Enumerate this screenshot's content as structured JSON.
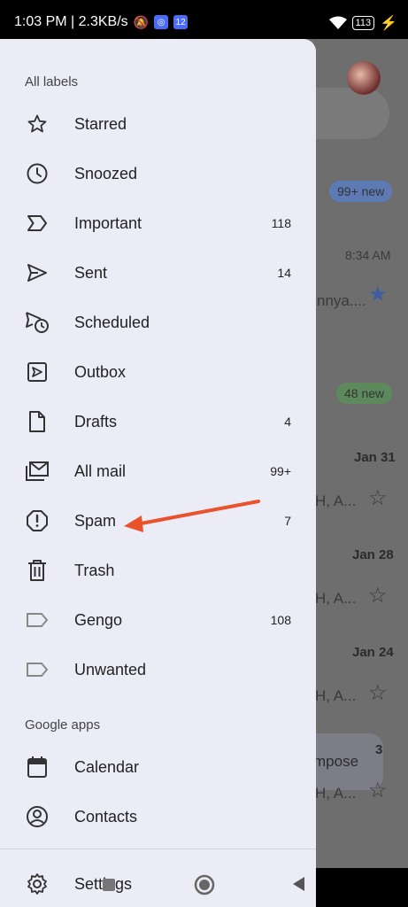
{
  "status_bar": {
    "time_info": "1:03 PM | 2.3KB/s",
    "sim_badge": "12",
    "battery": "113"
  },
  "drawer": {
    "all_labels_title": "All labels",
    "items": [
      {
        "label": "Starred",
        "count": "",
        "icon": "star-icon"
      },
      {
        "label": "Snoozed",
        "count": "",
        "icon": "clock-icon"
      },
      {
        "label": "Important",
        "count": "118",
        "icon": "important-icon"
      },
      {
        "label": "Sent",
        "count": "14",
        "icon": "send-icon"
      },
      {
        "label": "Scheduled",
        "count": "",
        "icon": "scheduled-icon"
      },
      {
        "label": "Outbox",
        "count": "",
        "icon": "outbox-icon"
      },
      {
        "label": "Drafts",
        "count": "4",
        "icon": "draft-icon"
      },
      {
        "label": "All mail",
        "count": "99+",
        "icon": "all-mail-icon"
      },
      {
        "label": "Spam",
        "count": "7",
        "icon": "spam-icon"
      },
      {
        "label": "Trash",
        "count": "",
        "icon": "trash-icon"
      },
      {
        "label": "Gengo",
        "count": "108",
        "icon": "label-icon"
      },
      {
        "label": "Unwanted",
        "count": "",
        "icon": "label-icon"
      }
    ],
    "google_apps_title": "Google apps",
    "apps": [
      {
        "label": "Calendar",
        "icon": "calendar-icon"
      },
      {
        "label": "Contacts",
        "icon": "contacts-icon"
      }
    ],
    "settings_label": "Settings"
  },
  "inbox_background": {
    "badge_new_1": "99+ new",
    "time_1": "8:34 AM",
    "snippet_1": "nnya....",
    "badge_new_2": "48 new",
    "date_1": "Jan 31",
    "snippet_2": "H, A...",
    "date_2": "Jan 28",
    "snippet_3": "H, A...",
    "date_3": "Jan 24",
    "snippet_4": "H, A...",
    "compose_label": "mpose",
    "snippet_5": "H, A...",
    "date_4": "3"
  },
  "colors": {
    "drawer_bg": "#ececf6",
    "annotation_arrow": "#e9532b",
    "scrim": "#6e6e6e"
  }
}
